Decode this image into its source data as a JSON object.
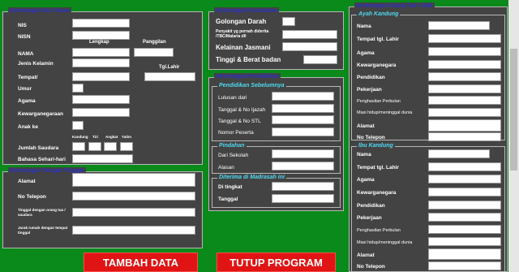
{
  "left": {
    "title": "Keterangan Diri Siswa",
    "fields": {
      "nis": "NIS",
      "nisn": "NISN",
      "lengkap": "Lengkap",
      "panggilan": "Panggilan",
      "nama": "NAMA",
      "jenis_kelamin": "Jenis Kelamin",
      "tgl_lahir": "Tgl.Lahir",
      "tempat": "Tempat/",
      "umur": "Umur",
      "agama": "Agama",
      "kewarganegaraan": "Kewarganegaraan",
      "anak_ke": "Anak ke",
      "kandung": "Kandung",
      "tiri": "Tiri",
      "angkat": "Angkat",
      "yatim": "Yatim",
      "jumlah_saudara": "Jumlah Saudara",
      "bahasa": "Bahasa Sehari-hari"
    }
  },
  "tinggal": {
    "title": "Keterangan Tempat Tinggal",
    "alamat": "Alamat",
    "telepon": "No Telepon",
    "tinggal_dengan": "Tinggal dengan orang tua / saudara",
    "jarak": "Jarak rumah dengan tempat tinggal"
  },
  "kesehatan": {
    "title": "Keterangan Kesehatan",
    "golongan_darah": "Golongan Darah",
    "penyakit": "Penyakit yg pernah diderita /TBC/Malaria dll",
    "kelainan": "Kelainan Jasmani",
    "tinggi": "Tinggi & Berat badan"
  },
  "pendidikan": {
    "title": "Keterangan Pendidikan",
    "sebelumnya_title": "Pendidikan Sebelumnya",
    "lulusan": "Lulusan dari",
    "ijazah": "Tanggal & No Ijazah",
    "stl": "Tanggal & No STL",
    "peserta": "Nomor Peserta",
    "pindahan_title": "Pindahan",
    "dari_sekolah": "Dari Sekolah",
    "alasan": "Alasan",
    "diterima_title": "Diterima di Madrasah ini",
    "di_tingkat": "Di tingkat",
    "tanggal": "Tanggal"
  },
  "ortu": {
    "title": "Keterangan Orang Tua / Wali",
    "ayah_title": "Ayah Kandung",
    "ibu_title": "Ibu Kandung",
    "nama": "Nama",
    "tempat_lahir": "Tempat tgl. Lahir",
    "agama": "Agama",
    "kewarganegaraan": "Kewarganegara",
    "pendidikan": "Pendidikan",
    "pekerjaan": "Pekerjaan",
    "penghasilan": "Penghasilan Perbulan",
    "masih_hidup": "Masi hidup/meninggal dunia",
    "alamat": "Alamat",
    "telepon": "No Telepon"
  },
  "buttons": {
    "tambah": "TAMBAH DATA",
    "tutup": "TUTUP PROGRAM"
  }
}
